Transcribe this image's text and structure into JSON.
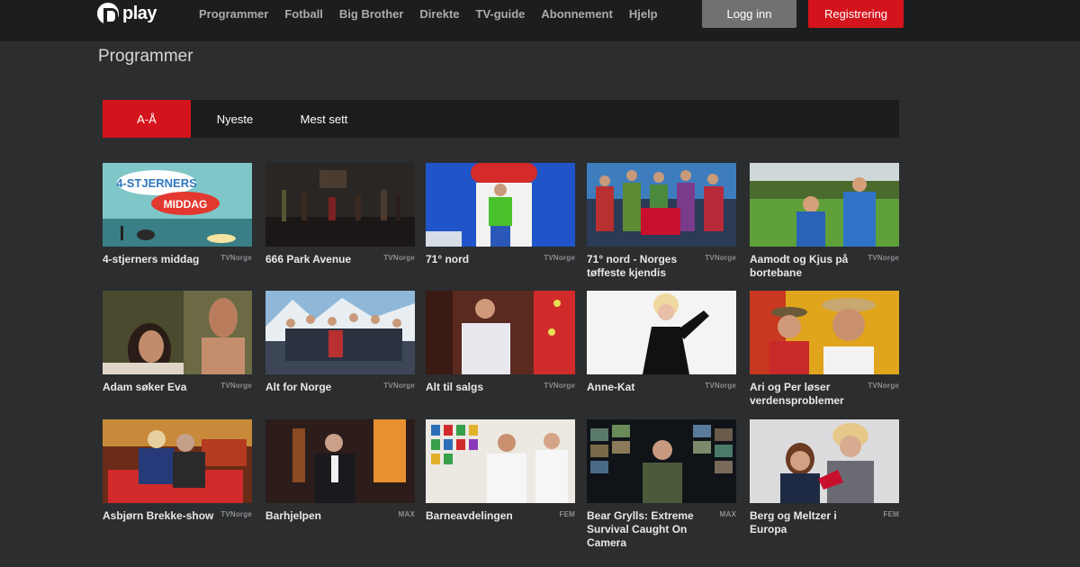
{
  "header": {
    "logo_text": "play",
    "nav": [
      "Programmer",
      "Fotball",
      "Big Brother",
      "Direkte",
      "TV-guide",
      "Abonnement",
      "Hjelp"
    ],
    "login_label": "Logg inn",
    "register_label": "Registrering"
  },
  "page": {
    "title": "Programmer"
  },
  "tabs": [
    "A-Å",
    "Nyeste",
    "Mest sett"
  ],
  "programs": [
    {
      "title": "4-stjerners middag",
      "channel": "TVNorge",
      "thumb_text": [
        "4-STJERNERS",
        "MIDDAG"
      ]
    },
    {
      "title": "666 Park Avenue",
      "channel": "TVNorge"
    },
    {
      "title": "71° nord",
      "channel": "TVNorge"
    },
    {
      "title": "71° nord - Norges tøffeste kjendis",
      "channel": "TVNorge"
    },
    {
      "title": "Aamodt og Kjus på bortebane",
      "channel": "TVNorge"
    },
    {
      "title": "Adam søker Eva",
      "channel": "TVNorge"
    },
    {
      "title": "Alt for Norge",
      "channel": "TVNorge"
    },
    {
      "title": "Alt til salgs",
      "channel": "TVNorge"
    },
    {
      "title": "Anne-Kat",
      "channel": "TVNorge"
    },
    {
      "title": "Ari og Per løser verdensproblemer",
      "channel": "TVNorge"
    },
    {
      "title": "Asbjørn Brekke-show",
      "channel": "TVNorge"
    },
    {
      "title": "Barhjelpen",
      "channel": "MAX"
    },
    {
      "title": "Barneavdelingen",
      "channel": "FEM"
    },
    {
      "title": "Bear Grylls: Extreme Survival Caught On Camera",
      "channel": "MAX"
    },
    {
      "title": "Berg og Meltzer i Europa",
      "channel": "FEM"
    }
  ],
  "colors": {
    "background": "#2b2d2f",
    "topbar": "#1c1d1e",
    "accent": "#d4141c",
    "login_button": "#6f7173"
  }
}
